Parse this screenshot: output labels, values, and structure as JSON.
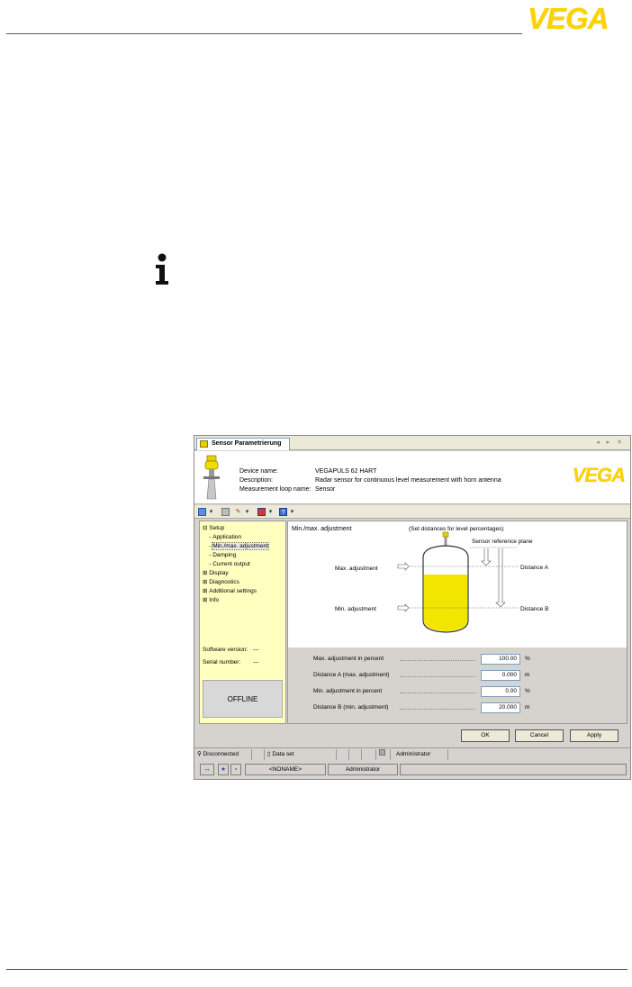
{
  "brand": {
    "logo_text": "VEGA",
    "color": "#ffd200"
  },
  "info_icon": "info-icon",
  "window": {
    "tab_label": "Sensor Parametrierung",
    "tab_nav": "◂ ▸ ✕",
    "header": {
      "labels": [
        "Device name:",
        "Description:",
        "Measurement loop name:"
      ],
      "values": [
        "VEGAPULS 62 HART",
        "Radar sensor for continuous level measurement with horn antenna",
        "Sensor"
      ],
      "logo_text": "VEGA"
    },
    "tree": {
      "items": [
        {
          "prefix": "⊟ ",
          "label": "Setup"
        },
        {
          "prefix": "    - ",
          "label": "Application"
        },
        {
          "prefix": "    - ",
          "label": "Min./max. adjustment",
          "selected": true
        },
        {
          "prefix": "    - ",
          "label": "Damping"
        },
        {
          "prefix": "    - ",
          "label": "Current output"
        },
        {
          "prefix": "⊞ ",
          "label": "Display"
        },
        {
          "prefix": "⊞ ",
          "label": "Diagnostics"
        },
        {
          "prefix": "⊞ ",
          "label": "Additional settings"
        },
        {
          "prefix": "⊞ ",
          "label": "Info"
        }
      ],
      "software_version_label": "Software version:",
      "software_version_value": "---",
      "serial_number_label": "Serial number:",
      "serial_number_value": "---",
      "offline_label": "OFFLINE"
    },
    "diagram": {
      "title": "Min./max. adjustment",
      "subtitle": "(Set distances for level percentages)",
      "reference_label": "Sensor reference plane",
      "max_label": "Max. adjustment",
      "min_label": "Min. adjustment",
      "distance_a_label": "Distance A",
      "distance_b_label": "Distance B",
      "fill_color": "#f2e600"
    },
    "form": [
      {
        "label": "Max. adjustment in percent",
        "value": "100.00",
        "unit": "%"
      },
      {
        "label": "Distance A (max. adjustment)",
        "value": "0.000",
        "unit": "m"
      },
      {
        "label": "Min. adjustment in percent",
        "value": "0.00",
        "unit": "%"
      },
      {
        "label": "Distance B (min. adjustment)",
        "value": "20.000",
        "unit": "m"
      }
    ],
    "buttons": {
      "ok": "OK",
      "cancel": "Cancel",
      "apply": "Apply"
    },
    "status": {
      "connection": "Disconnected",
      "dataset": "Data set",
      "user": "Administrator"
    },
    "status2": {
      "project": "<NONAME>",
      "user": "Administrator"
    }
  }
}
